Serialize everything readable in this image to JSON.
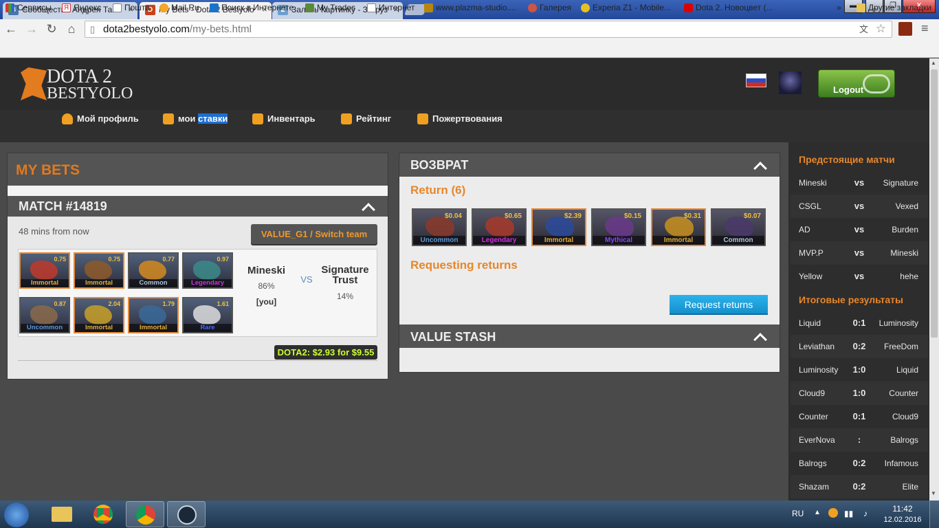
{
  "browser": {
    "tabs": [
      {
        "title": "Сообщества Андрея Танч",
        "icon": "vk-icon",
        "active": false
      },
      {
        "title": "My Bets - Dota 2 Bestyolo",
        "icon": "dota-icon",
        "active": true
      },
      {
        "title": "Залить Картинку - Загруз",
        "icon": "image-icon",
        "active": false
      }
    ],
    "url_host": "dota2bestyolo.com",
    "url_path": "/my-bets.html",
    "bookmarks": [
      "Сервисы",
      "Яндекс",
      "Пошта",
      "Mail.Ru",
      "Поиск в Интернете",
      "My Trades",
      "Интернет",
      "www.plazma-studio....",
      "Галерея",
      "Experia Z1 - Mobile...",
      "Dota 2. Новоцвет (..."
    ],
    "bookmarks_more": "»",
    "other_bookmarks": "Другие закладки"
  },
  "site": {
    "logo_line1": "DOTA 2",
    "logo_line2": "BESTYOLO",
    "logout_label": "Logout",
    "nav": [
      {
        "label": "Мой профиль",
        "icon": "user-icon"
      },
      {
        "label": "мои",
        "highlight": "ставки",
        "icon": "dice-icon"
      },
      {
        "label": "Инвентарь",
        "icon": "cart-icon"
      },
      {
        "label": "Рейтинг",
        "icon": "bars-icon"
      },
      {
        "label": "Пожертвования",
        "icon": "donate-icon"
      }
    ]
  },
  "colors": {
    "accent": "#e8862a",
    "highlight": "#1f6fcf",
    "button_green": "#4caf50",
    "request_blue": "#1a9fdc",
    "total_lime": "#ccff33"
  },
  "bets": {
    "title": "MY BETS",
    "match_title": "MATCH #14819",
    "time": "48 mins from now",
    "switch_label": "VALUE_G1 / Switch team",
    "team1": "Mineski",
    "team1_pct": "86%",
    "you_label": "[you]",
    "vs": "VS",
    "team2": "Signature Trust",
    "team2_pct": "14%",
    "items": [
      {
        "price": "0.75",
        "rarity": "Immortal",
        "color": "#e4ae39"
      },
      {
        "price": "0.75",
        "rarity": "Immortal",
        "color": "#e4ae39"
      },
      {
        "price": "0.77",
        "rarity": "Common",
        "color": "#b0c3d9"
      },
      {
        "price": "0.97",
        "rarity": "Legendary",
        "color": "#d32ce6"
      },
      {
        "price": "0.87",
        "rarity": "Uncommon",
        "color": "#5e98d9"
      },
      {
        "price": "2.04",
        "rarity": "Immortal",
        "color": "#e4ae39"
      },
      {
        "price": "1.79",
        "rarity": "Immortal",
        "color": "#e4ae39"
      },
      {
        "price": "1.61",
        "rarity": "Rare",
        "color": "#4b69ff"
      }
    ],
    "total": "DOTA2: $2.93 for $9.55"
  },
  "returns": {
    "title": "ВОЗВРАТ",
    "return_label": "Return (6)",
    "items": [
      {
        "price": "$0.04",
        "rarity": "Uncommon",
        "color": "#5e98d9"
      },
      {
        "price": "$0.65",
        "rarity": "Legendary",
        "color": "#d32ce6"
      },
      {
        "price": "$2.39",
        "rarity": "Immortal",
        "color": "#e4ae39"
      },
      {
        "price": "$0.15",
        "rarity": "Mythical",
        "color": "#8847ff"
      },
      {
        "price": "$0.31",
        "rarity": "Immortal",
        "color": "#e4ae39"
      },
      {
        "price": "$0.07",
        "rarity": "Common",
        "color": "#b0c3d9"
      }
    ],
    "requesting_label": "Requesting returns",
    "request_button": "Request returns",
    "stash_title": "VALUE STASH"
  },
  "sidebar": {
    "upcoming_title": "Предстоящие матчи",
    "upcoming": [
      {
        "t1": "Mineski",
        "mid": "vs",
        "t2": "Signature"
      },
      {
        "t1": "CSGL",
        "mid": "vs",
        "t2": "Vexed"
      },
      {
        "t1": "AD",
        "mid": "vs",
        "t2": "Burden"
      },
      {
        "t1": "MVP.P",
        "mid": "vs",
        "t2": "Mineski"
      },
      {
        "t1": "Yellow",
        "mid": "vs",
        "t2": "hehe"
      }
    ],
    "results_title": "Итоговые результаты",
    "results": [
      {
        "t1": "Liquid",
        "mid": "0:1",
        "t2": "Luminosity"
      },
      {
        "t1": "Leviathan",
        "mid": "0:2",
        "t2": "FreeDom"
      },
      {
        "t1": "Luminosity",
        "mid": "1:0",
        "t2": "Liquid"
      },
      {
        "t1": "Cloud9",
        "mid": "1:0",
        "t2": "Counter"
      },
      {
        "t1": "Counter",
        "mid": "0:1",
        "t2": "Cloud9"
      },
      {
        "t1": "EverNova",
        "mid": ":",
        "t2": "Balrogs"
      },
      {
        "t1": "Balrogs",
        "mid": "0:2",
        "t2": "Infamous"
      },
      {
        "t1": "Shazam",
        "mid": "0:2",
        "t2": "Elite"
      }
    ]
  },
  "taskbar": {
    "lang": "RU",
    "time": "11:42",
    "date": "12.02.2016"
  }
}
